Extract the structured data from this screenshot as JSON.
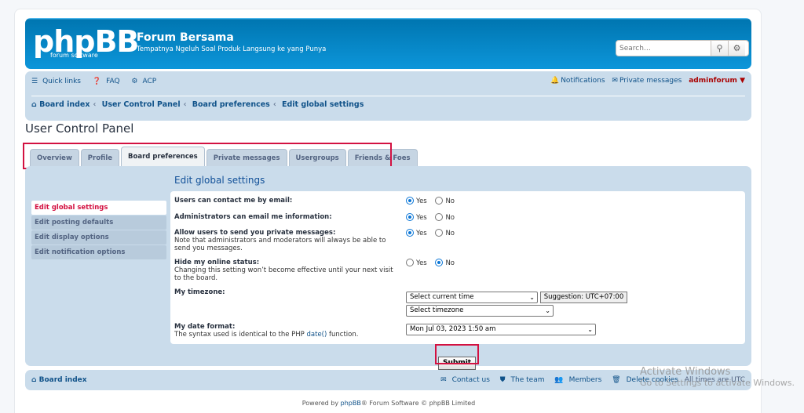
{
  "header": {
    "logo": "phpBB",
    "logo_sub": "forum software",
    "site_title": "Forum Bersama",
    "site_desc": "Tempatnya Ngeluh Soal Produk Langsung ke yang Punya",
    "search_placeholder": "Search…"
  },
  "navbar": {
    "quick_links": "Quick links",
    "faq": "FAQ",
    "acp": "ACP",
    "notifications": "Notifications",
    "private_messages": "Private messages",
    "username": "adminforum"
  },
  "breadcrumbs": [
    "Board index",
    "User Control Panel",
    "Board preferences",
    "Edit global settings"
  ],
  "page_title": "User Control Panel",
  "tabs": [
    {
      "label": "Overview"
    },
    {
      "label": "Profile"
    },
    {
      "label": "Board preferences",
      "active": true
    },
    {
      "label": "Private messages"
    },
    {
      "label": "Usergroups"
    },
    {
      "label": "Friends & Foes"
    }
  ],
  "sidemenu": [
    {
      "label": "Edit global settings",
      "active": true
    },
    {
      "label": "Edit posting defaults"
    },
    {
      "label": "Edit display options"
    },
    {
      "label": "Edit notification options"
    }
  ],
  "panel_title": "Edit global settings",
  "settings": {
    "email": {
      "label": "Users can contact me by email:",
      "yes": "Yes",
      "no": "No",
      "value": "Yes"
    },
    "admin_email": {
      "label": "Administrators can email me information:",
      "yes": "Yes",
      "no": "No",
      "value": "Yes"
    },
    "pm": {
      "label": "Allow users to send you private messages:",
      "note": "Note that administrators and moderators will always be able to send you messages.",
      "yes": "Yes",
      "no": "No",
      "value": "Yes"
    },
    "hide_online": {
      "label": "Hide my online status:",
      "note": "Changing this setting won’t become effective until your next visit to the board.",
      "yes": "Yes",
      "no": "No",
      "value": "No"
    },
    "timezone": {
      "label": "My timezone:",
      "select1": "Select current time",
      "suggestion": "Suggestion: UTC+07:00",
      "select2": "Select timezone"
    },
    "dateformat": {
      "label": "My date format:",
      "note_pre": "The syntax used is identical to the PHP ",
      "note_link": "date()",
      "note_post": " function.",
      "value": "Mon Jul 03, 2023 1:50 am"
    }
  },
  "submit": "Submit",
  "footer": {
    "board_index": "Board index",
    "contact": "Contact us",
    "team": "The team",
    "members": "Members",
    "delete_cookies": "Delete cookies",
    "times": "All times are UTC"
  },
  "powered": {
    "pre": "Powered by ",
    "link": "phpBB",
    "post": "® Forum Software © phpBB Limited"
  },
  "watermark": {
    "line1": "Activate Windows",
    "line2": "Go to Settings to activate Windows."
  }
}
